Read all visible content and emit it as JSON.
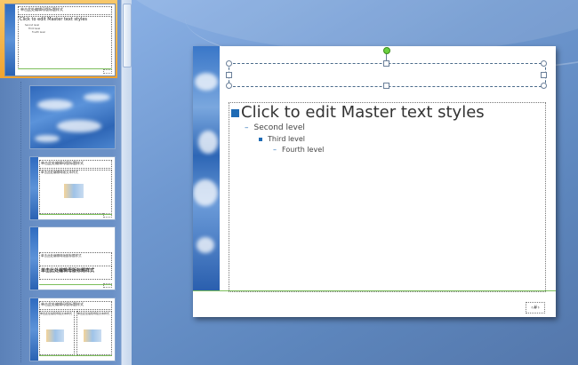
{
  "slide": {
    "level1": "Click to edit Master text styles",
    "level2": "Second level",
    "level3": "Third level",
    "level4": "Fourth level",
    "page_number": "‹#›"
  },
  "thumbnails": {
    "thumb1": {
      "title": "单击此处编辑母版标题样式",
      "body": "Click to edit Master text styles",
      "sub1": "Second level",
      "sub2": "Third level",
      "sub3": "Fourth level"
    },
    "thumb3": {
      "title": "单击此处编辑母版标题样式",
      "body": "单击此处编辑母版文本样式"
    },
    "thumb4": {
      "title": "单击此处编辑母版标题样式",
      "body": "单击此处编辑母版副标题样式"
    },
    "thumb5": {
      "title": "单击此处编辑母版标题样式",
      "col1": "单击此处编辑母版文本样式",
      "col2": "单击此处编辑母版文本样式"
    }
  },
  "colors": {
    "accent_blue": "#1f6bb5",
    "selection_orange": "#f0a330",
    "rule_green": "#7cbf5b",
    "rotate_handle": "#6bd13f"
  },
  "icons": [
    "rotate-handle-icon",
    "resize-handle-icon",
    "bullet-square-icon"
  ]
}
